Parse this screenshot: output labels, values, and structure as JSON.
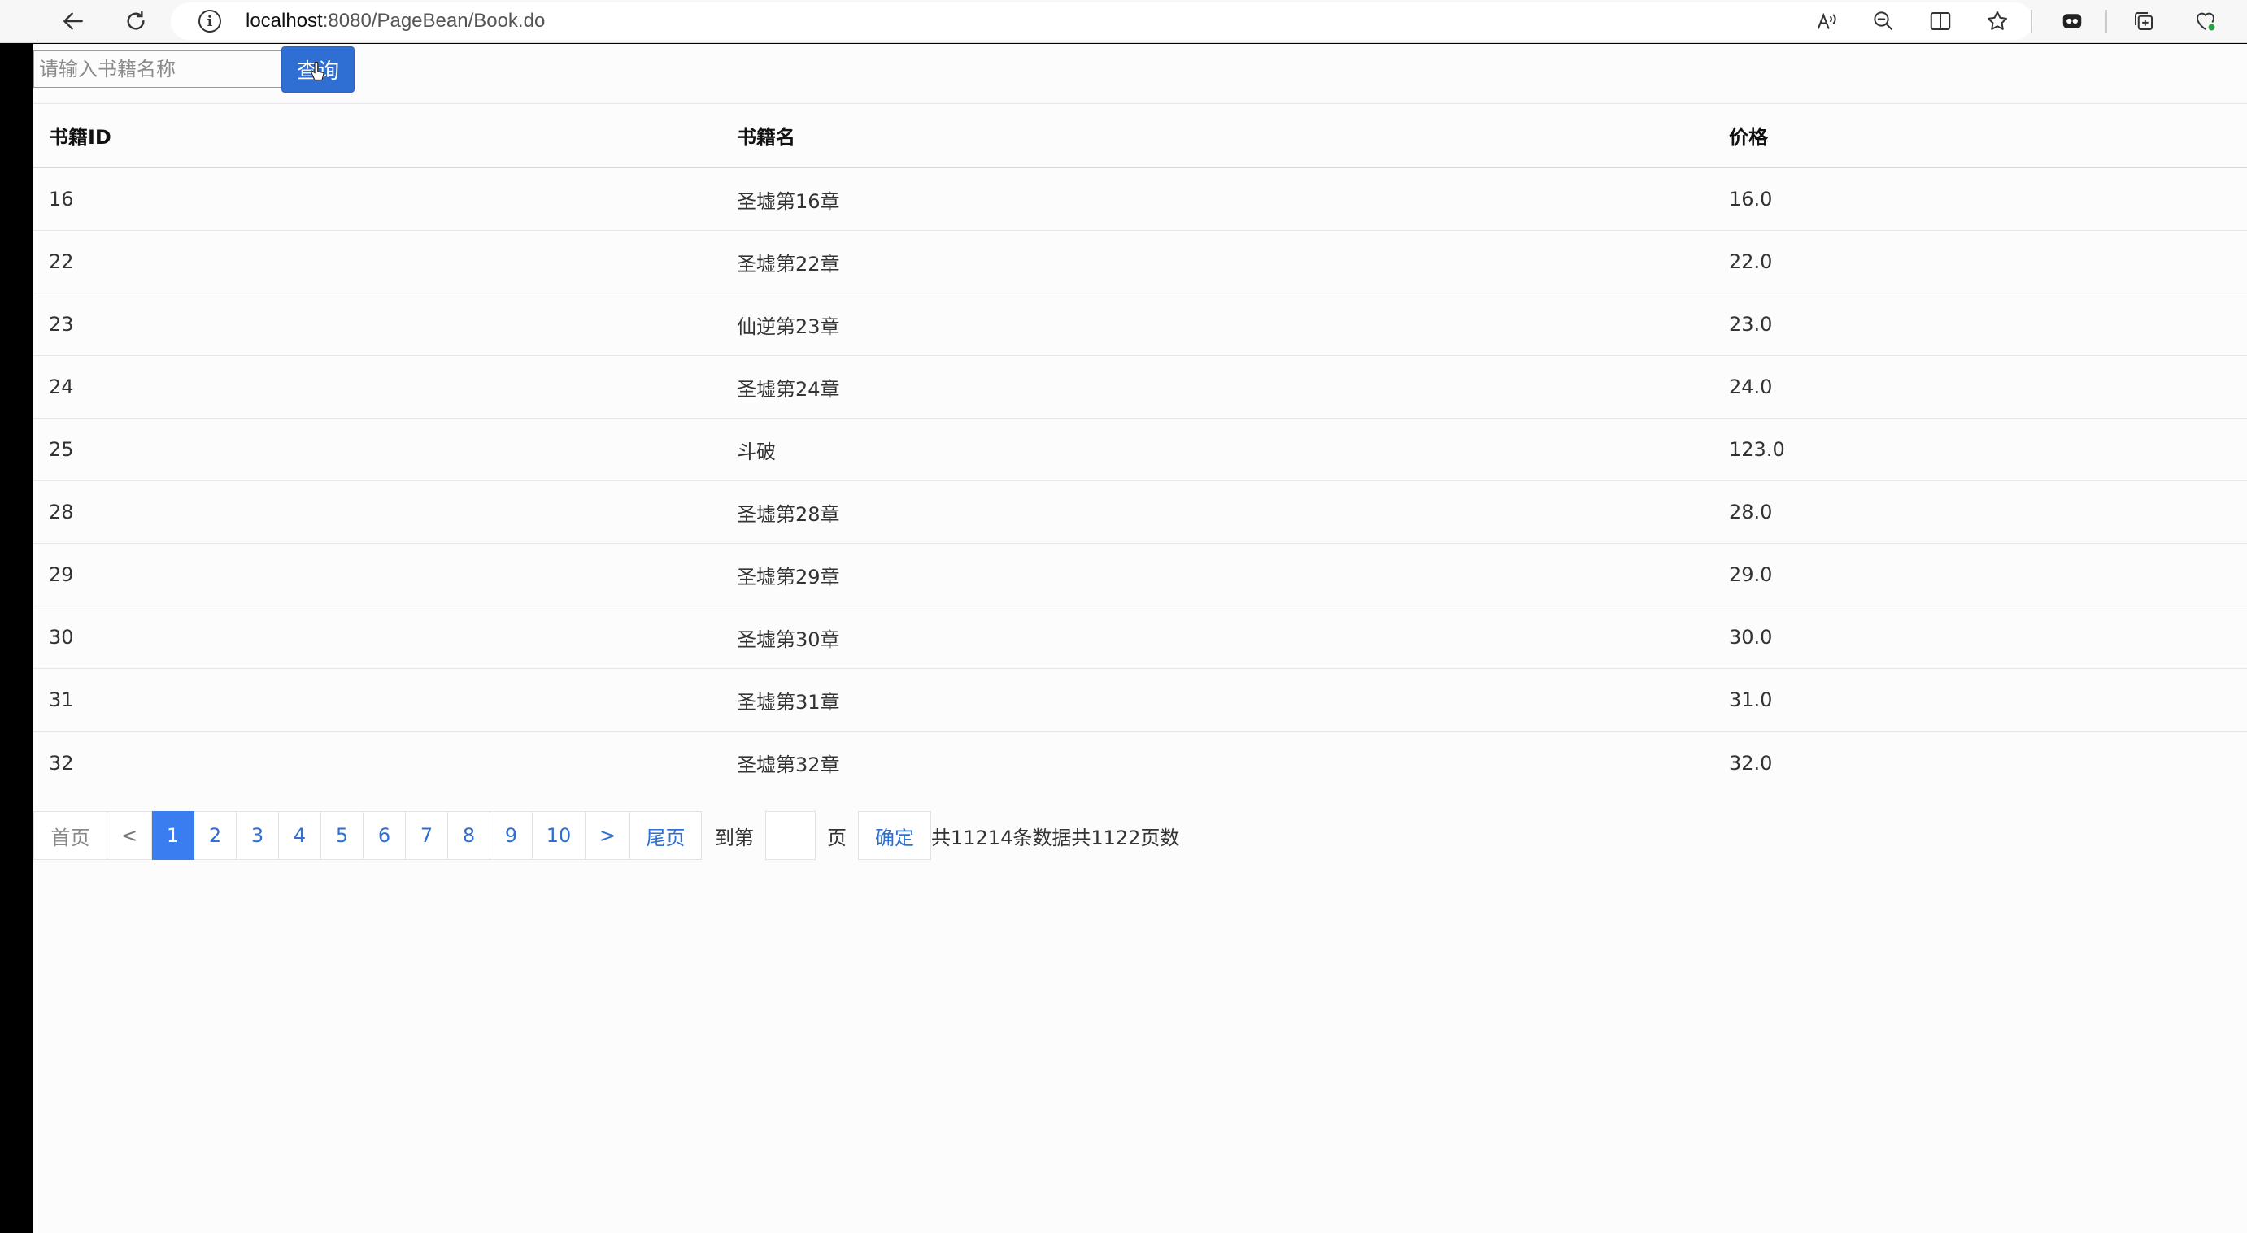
{
  "browser": {
    "url_host": "localhost",
    "url_path": ":8080/PageBean/Book.do",
    "icons": [
      "back-arrow-icon",
      "refresh-icon",
      "info-icon",
      "read-aloud-icon",
      "zoom-out-icon",
      "split-screen-icon",
      "favorite-star-icon",
      "extension-icon",
      "collections-icon",
      "browser-essentials-icon"
    ]
  },
  "search": {
    "placeholder": "请输入书籍名称",
    "button_label": "查询"
  },
  "table": {
    "headers": [
      "书籍ID",
      "书籍名",
      "价格"
    ],
    "rows": [
      [
        "16",
        "圣墟第16章",
        "16.0"
      ],
      [
        "22",
        "圣墟第22章",
        "22.0"
      ],
      [
        "23",
        "仙逆第23章",
        "23.0"
      ],
      [
        "24",
        "圣墟第24章",
        "24.0"
      ],
      [
        "25",
        "斗破",
        "123.0"
      ],
      [
        "28",
        "圣墟第28章",
        "28.0"
      ],
      [
        "29",
        "圣墟第29章",
        "29.0"
      ],
      [
        "30",
        "圣墟第30章",
        "30.0"
      ],
      [
        "31",
        "圣墟第31章",
        "31.0"
      ],
      [
        "32",
        "圣墟第32章",
        "32.0"
      ]
    ]
  },
  "pagination": {
    "first": "首页",
    "prev": "<",
    "pages": [
      "1",
      "2",
      "3",
      "4",
      "5",
      "6",
      "7",
      "8",
      "9",
      "10"
    ],
    "current": "1",
    "next": ">",
    "last": "尾页",
    "goto_prefix": "到第",
    "goto_suffix": "页",
    "confirm": "确定",
    "summary": "共11214条数据共1122页数"
  },
  "colors": {
    "accent": "#2f6fd4",
    "active_page": "#3a7df0"
  }
}
